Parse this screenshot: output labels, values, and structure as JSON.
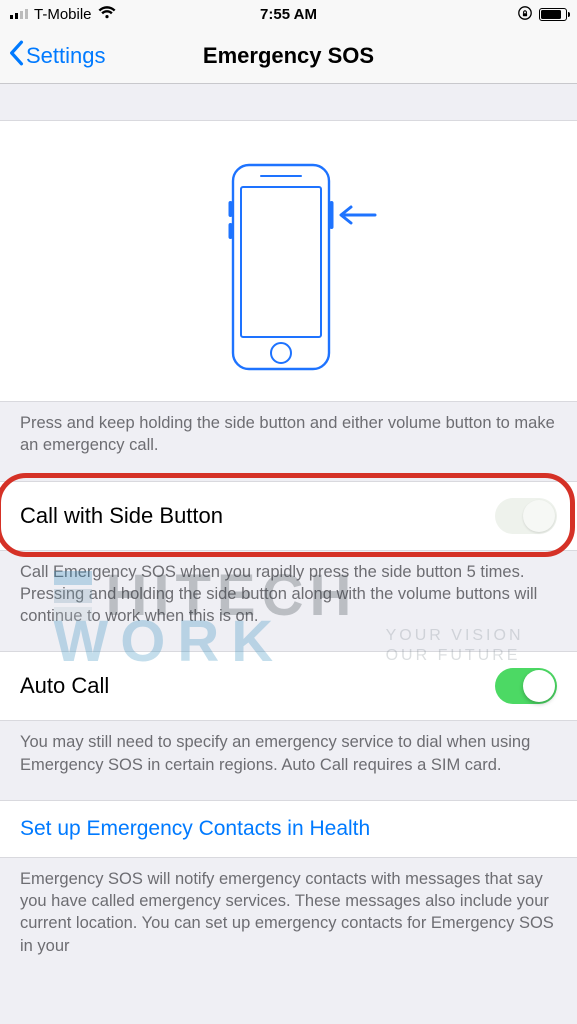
{
  "status": {
    "carrier": "T-Mobile",
    "time": "7:55 AM"
  },
  "nav": {
    "back_label": "Settings",
    "title": "Emergency SOS"
  },
  "section1": {
    "footer": "Press and keep holding the side button and either volume button to make an emergency call."
  },
  "row_call_side": {
    "label": "Call with Side Button",
    "on": false,
    "footer": "Call Emergency SOS when you rapidly press the side button 5 times. Pressing and holding the side button along with the volume buttons will continue to work when this is on."
  },
  "row_auto_call": {
    "label": "Auto Call",
    "on": true,
    "footer": "You may still need to specify an emergency service to dial when using Emergency SOS in certain regions. Auto Call requires a SIM card."
  },
  "row_setup": {
    "label": "Set up Emergency Contacts in Health",
    "footer": "Emergency SOS will notify emergency contacts with messages that say you have called emergency services. These messages also include your current location. You can set up emergency contacts for Emergency SOS in your"
  },
  "watermark": {
    "line1": "HITECH",
    "line2": "WORK",
    "tag1": "YOUR VISION",
    "tag2": "OUR FUTURE"
  }
}
